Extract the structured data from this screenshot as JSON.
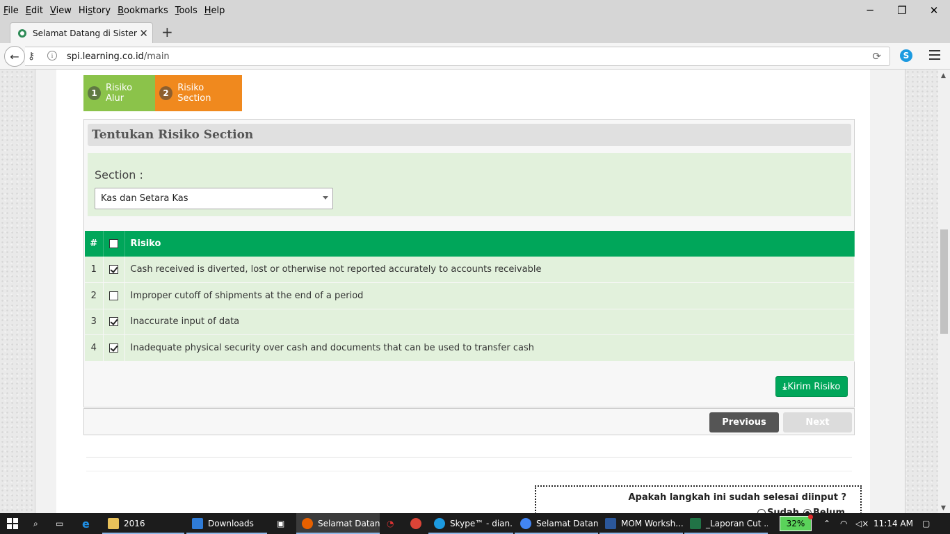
{
  "browser": {
    "menu": [
      "File",
      "Edit",
      "View",
      "History",
      "Bookmarks",
      "Tools",
      "Help"
    ],
    "menu_accel": [
      "F",
      "E",
      "V",
      "s",
      "B",
      "T",
      "H"
    ],
    "tab_title": "Selamat Datang di Sistem ...",
    "url_host": "spi.learning.co.id",
    "url_path": "/main",
    "window_controls": {
      "minimize": "─",
      "restore": "❐",
      "close": "✕"
    }
  },
  "steps": [
    {
      "num": "1",
      "label": "Risiko Alur",
      "color": "#8bc34a"
    },
    {
      "num": "2",
      "label": "Risiko Section",
      "color": "#f0891e"
    }
  ],
  "panel": {
    "title": "Tentukan Risiko Section",
    "section_label": "Section :",
    "section_value": "Kas dan Setara Kas"
  },
  "table": {
    "headers": [
      "#",
      "",
      "Risiko"
    ],
    "header_checked": false,
    "rows": [
      {
        "no": "1",
        "checked": true,
        "text": "Cash received is diverted, lost or otherwise not reported accurately to accounts receivable"
      },
      {
        "no": "2",
        "checked": false,
        "text": "Improper cutoff of shipments at the end of a period"
      },
      {
        "no": "3",
        "checked": true,
        "text": "Inaccurate input of data"
      },
      {
        "no": "4",
        "checked": true,
        "text": "Inadequate physical security over cash and documents that can be used to transfer cash"
      }
    ]
  },
  "buttons": {
    "kirim": "Kirim Risiko",
    "previous": "Previous",
    "next": "Next"
  },
  "question": {
    "text": "Apakah langkah ini sudah selesai diinput ?",
    "options": [
      {
        "label": "Sudah",
        "selected": false
      },
      {
        "label": "Belum",
        "selected": true
      }
    ]
  },
  "colors": {
    "green": "#00a65a",
    "light_green": "#e2f1dc",
    "orange": "#f0891e",
    "lime": "#8bc34a"
  },
  "taskbar": {
    "items": [
      {
        "label": "2016",
        "icon": "folder-icon"
      },
      {
        "label": "Downloads",
        "icon": "download-icon"
      },
      {
        "label": "Selamat Datan...",
        "icon": "firefox-icon",
        "active": true
      },
      {
        "label": "Skype™ - dian...",
        "icon": "skype-icon"
      },
      {
        "label": "Selamat Datan...",
        "icon": "chrome-icon"
      },
      {
        "label": "MOM Worksh...",
        "icon": "word-icon"
      },
      {
        "label": "_Laporan Cut ...",
        "icon": "excel-icon"
      }
    ],
    "battery": "32%",
    "time": "11:14 AM"
  }
}
